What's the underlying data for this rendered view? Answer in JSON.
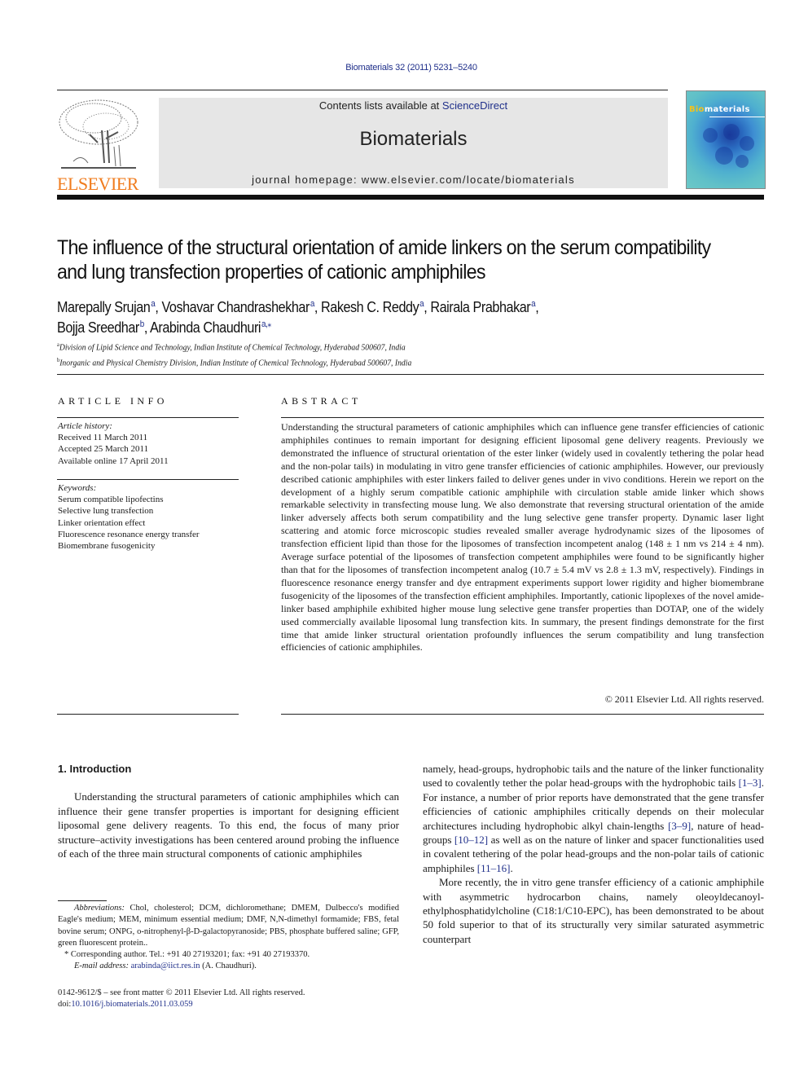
{
  "header": {
    "citation": "Biomaterials 32 (2011) 5231–5240",
    "contents_prefix": "Contents lists available at ",
    "contents_link": "ScienceDirect",
    "journal_name": "Biomaterials",
    "homepage": "journal homepage: www.elsevier.com/locate/biomaterials",
    "publisher_logo_text": "ELSEVIER",
    "cover_title_accent": "Bio",
    "cover_title_rest": "materials",
    "colors": {
      "link": "#1f2f8a",
      "elsevier_orange": "#f07c1e",
      "banner_bg": "#e6e6e6"
    }
  },
  "article": {
    "title": "The influence of the structural orientation of amide linkers on the serum compatibility and lung transfection properties of cationic amphiphiles",
    "authors": [
      {
        "name": "Marepally Srujan",
        "sup": "a",
        "sep": ", "
      },
      {
        "name": "Voshavar Chandrashekhar",
        "sup": "a",
        "sep": ", "
      },
      {
        "name": "Rakesh C. Reddy",
        "sup": "a",
        "sep": ", "
      },
      {
        "name": "Rairala Prabhakar",
        "sup": "a",
        "sep": ","
      },
      {
        "name": "Bojja Sreedhar",
        "sup": "b",
        "sep": ", "
      },
      {
        "name": "Arabinda Chaudhuri",
        "sup": "a,⁎",
        "sep": ""
      }
    ],
    "affiliations": [
      {
        "sup": "a",
        "text": "Division of Lipid Science and Technology, Indian Institute of Chemical Technology, Hyderabad 500607, India"
      },
      {
        "sup": "b",
        "text": "Inorganic and Physical Chemistry Division, Indian Institute of Chemical Technology, Hyderabad 500607, India"
      }
    ]
  },
  "article_info": {
    "heading": "ARTICLE INFO",
    "history_label": "Article history:",
    "history": [
      "Received 11 March 2011",
      "Accepted 25 March 2011",
      "Available online 17 April 2011"
    ],
    "keywords_label": "Keywords:",
    "keywords": [
      "Serum compatible lipofectins",
      "Selective lung transfection",
      "Linker orientation effect",
      "Fluorescence resonance energy transfer",
      "Biomembrane fusogenicity"
    ]
  },
  "abstract": {
    "heading": "ABSTRACT",
    "text": "Understanding the structural parameters of cationic amphiphiles which can influence gene transfer efficiencies of cationic amphiphiles continues to remain important for designing efficient liposomal gene delivery reagents. Previously we demonstrated the influence of structural orientation of the ester linker (widely used in covalently tethering the polar head and the non-polar tails) in modulating in vitro gene transfer efficiencies of cationic amphiphiles. However, our previously described cationic amphiphiles with ester linkers failed to deliver genes under in vivo conditions. Herein we report on the development of a highly serum compatible cationic amphiphile with circulation stable amide linker which shows remarkable selectivity in transfecting mouse lung. We also demonstrate that reversing structural orientation of the amide linker adversely affects both serum compatibility and the lung selective gene transfer property. Dynamic laser light scattering and atomic force microscopic studies revealed smaller average hydrodynamic sizes of the liposomes of transfection efficient lipid than those for the liposomes of transfection incompetent analog (148 ± 1 nm vs 214 ± 4 nm). Average surface potential of the liposomes of transfection competent amphiphiles were found to be significantly higher than that for the liposomes of transfection incompetent analog (10.7 ± 5.4 mV vs 2.8 ± 1.3 mV, respectively). Findings in fluorescence resonance energy transfer and dye entrapment experiments support lower rigidity and higher biomembrane fusogenicity of the liposomes of the transfection efficient amphiphiles. Importantly, cationic lipoplexes of the novel amide-linker based amphiphile exhibited higher mouse lung selective gene transfer properties than DOTAP, one of the widely used commercially available liposomal lung transfection kits. In summary, the present findings demonstrate for the first time that amide linker structural orientation profoundly influences the serum compatibility and lung transfection efficiencies of cationic amphiphiles.",
    "copyright": "© 2011 Elsevier Ltd. All rights reserved."
  },
  "body": {
    "intro_heading": "1.  Introduction",
    "left_para": "Understanding the structural parameters of cationic amphiphiles which can influence their gene transfer properties is important for designing efficient liposomal gene delivery reagents. To this end, the focus of many prior structure–activity investigations has been centered around probing the influence of each of the three main structural components of cationic amphiphiles",
    "right_para1": [
      {
        "t": "namely, head-groups, hydrophobic tails and the nature of the linker functionality used to covalently tether the polar head-groups with the hydrophobic tails "
      },
      {
        "ref": "[1–3]"
      },
      {
        "t": ". For instance, a number of prior reports have demonstrated that the gene transfer efficiencies of cationic amphiphiles critically depends on their molecular architectures including hydrophobic alkyl chain-lengths "
      },
      {
        "ref": "[3–9]"
      },
      {
        "t": ", nature of head-groups "
      },
      {
        "ref": "[10–12]"
      },
      {
        "t": " as well as on the nature of linker and spacer functionalities used in covalent tethering of the polar head-groups and the non-polar tails of cationic amphiphiles "
      },
      {
        "ref": "[11–16]"
      },
      {
        "t": "."
      }
    ],
    "right_para2": "More recently, the in vitro gene transfer efficiency of a cationic amphiphile with asymmetric hydrocarbon chains, namely oleoyldecanoyl-ethylphosphatidylcholine (C18:1/C10-EPC), has been demonstrated to be about 50 fold superior to that of its structurally very similar saturated asymmetric counterpart"
  },
  "footnotes": {
    "abbr_label": "Abbreviations:",
    "abbr_text": " Chol, cholesterol; DCM, dichloromethane; DMEM, Dulbecco's modified Eagle's medium; MEM, minimum essential medium; DMF, N,N-dimethyl formamide; FBS, fetal bovine serum; ONPG, o-nitrophenyl-β-D-galactopyranoside; PBS, phosphate buffered saline; GFP, green fluorescent protein..",
    "corresponding": "* Corresponding author. Tel.: +91 40 27193201; fax: +91 40 27193370.",
    "email_label": "E-mail address: ",
    "email": "arabinda@iict.res.in",
    "email_suffix": " (A. Chaudhuri).",
    "front_matter": "0142-9612/$ – see front matter © 2011 Elsevier Ltd. All rights reserved.",
    "doi_label": "doi:",
    "doi": "10.1016/j.biomaterials.2011.03.059"
  }
}
